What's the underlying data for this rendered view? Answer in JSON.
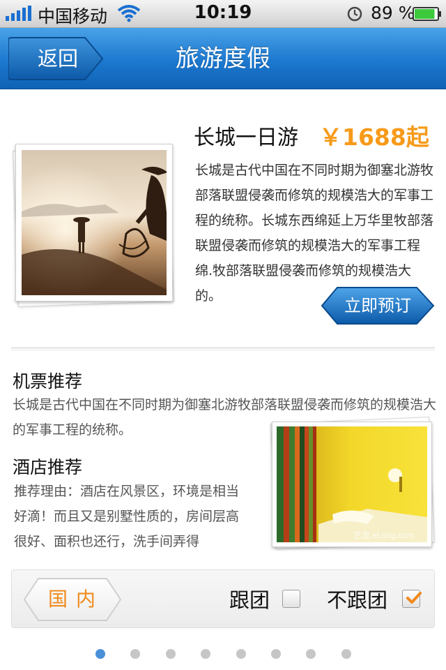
{
  "status_bar": {
    "carrier": "中国移动",
    "time": "10:19",
    "battery": "89 %",
    "battery_level": 0.89
  },
  "nav": {
    "back_label": "返回",
    "title": "旅游度假",
    "accent": "#1c78cf"
  },
  "trip": {
    "title": "长城一日游",
    "price": "￥1688起",
    "price_color": "#f79a1a",
    "description": "长城是古代中国在不同时期为御塞北游牧部落联盟侵袭而修筑的规模浩大的军事工程的统称。长城东西绵延上万华里牧部落联盟侵袭而修筑的规模浩大的军事工程绵.牧部落联盟侵袭而修筑的规模浩大的。",
    "book_label": "立即预订"
  },
  "flight": {
    "heading": "机票推荐",
    "description": "长城是古代中国在不同时期为御塞北游牧部落联盟侵袭而修筑的规模浩大的军事工程的统称。"
  },
  "hotel": {
    "heading": "酒店推荐",
    "description": "推荐理由：酒店在风景区，环境是相当好滴！而且又是别墅性质的，房间层高很好、面积也还行，洗手间弄得",
    "watermark": "艺龙 eLong.com"
  },
  "filter": {
    "domestic_label": "国内",
    "group_tour_label": "跟团",
    "group_tour_checked": false,
    "independent_label": "不跟团",
    "independent_checked": true
  },
  "pager": {
    "total": 8,
    "active_index": 0
  }
}
